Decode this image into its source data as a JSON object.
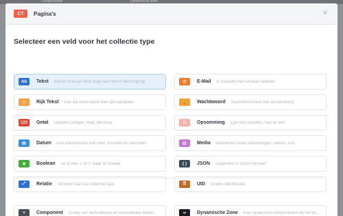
{
  "backdrop": {
    "text1": "Componenten",
    "text2": "Dynamische zone"
  },
  "modal": {
    "badge": "CT",
    "title": "Pagina's",
    "close_icon": "close-icon",
    "section_title": "Selecteer een veld voor het collectie type"
  },
  "fields": [
    {
      "name": "Tekst",
      "desc": "Kleine of lange tekst zoals een titel of beschrijving",
      "icon": "Ab",
      "color": "#2f6fd6",
      "selected": true
    },
    {
      "name": "E-Mail",
      "desc": "E-mailveld met formaat validatie",
      "icon": "@",
      "color": "#f07a2a"
    },
    {
      "name": "Rijk Tekst",
      "desc": "Een rijk tekst-editor met opmaakopties",
      "icon": "≡",
      "color": "#f6a14a"
    },
    {
      "name": "Wachtwoord",
      "desc": "Wachtwoordveld met versleuteling",
      "icon": "🔒",
      "color": "#f3a13a"
    },
    {
      "name": "Getal",
      "desc": "Getallen (integer, float, decimal)",
      "icon": "123",
      "color": "#e0452f"
    },
    {
      "name": "Opsomming",
      "desc": "Lijst met waarden, kies er een",
      "icon": "☰",
      "color": "#f4b2a8"
    },
    {
      "name": "Datum",
      "desc": "Een datumkiezer met uren, minuten en seconden",
      "icon": "▦",
      "color": "#3b8fe0"
    },
    {
      "name": "Media",
      "desc": "Bestanden zoals afbeeldingen, video's, enz",
      "icon": "▨",
      "color": "#c57ad8"
    },
    {
      "name": "Boolean",
      "desc": "Ja of nee, 1 of 0, waar of onwaar",
      "icon": "◉",
      "color": "#3fae3a"
    },
    {
      "name": "JSON",
      "desc": "Gegevens in JSON formaat",
      "icon": "{ }",
      "color": "#3a4a5c"
    },
    {
      "name": "Relatie",
      "desc": "Verwijst naar een collectie type",
      "icon": "⤢",
      "color": "#2f6fd6"
    },
    {
      "name": "UID",
      "desc": "Unieke identificatie",
      "icon": "⚿",
      "color": "#c06a2a"
    }
  ],
  "extra_fields": [
    {
      "name": "Component",
      "desc": "Groep van herbruikbare en herhaalbare velden",
      "icon": "⑂",
      "color": "#4a4f57"
    },
    {
      "name": "Dynamische Zone",
      "desc": "Kies dynamisch componenten bij het be...",
      "icon": "∞",
      "color": "#1a1d21"
    }
  ]
}
